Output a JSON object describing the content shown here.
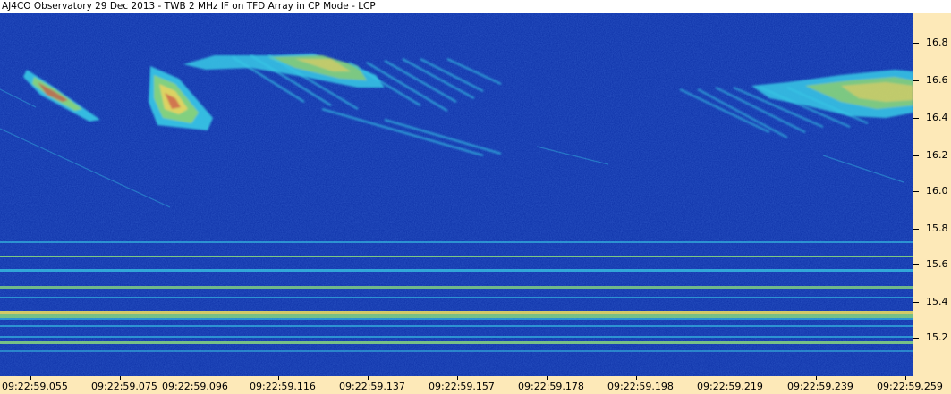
{
  "window": {
    "title": "AJ4CO Observatory 29 Dec 2013 - TWB 2 MHz IF on TFD Array in CP Mode - LCP"
  },
  "axes": {
    "y_unit_note": "",
    "y_ticks": [
      "16.8",
      "16.6",
      "16.4",
      "16.2",
      "16.0",
      "15.8",
      "15.6",
      "15.4",
      "15.2"
    ],
    "x_ticks": [
      "09:22:59.055",
      "09:22:59.075",
      "09:22:59.096",
      "09:22:59.116",
      "09:22:59.137",
      "09:22:59.157",
      "09:22:59.178",
      "09:22:59.198",
      "09:22:59.219",
      "09:22:59.239",
      "09:22:59.259"
    ]
  },
  "colors": {
    "background_blue": "#0b2fa6",
    "axis_panel": "#fde9b8",
    "signal_cyan": "#39c9e6",
    "signal_green": "#8ee07a",
    "signal_yellow": "#f2e35a",
    "signal_red": "#e0503a"
  }
}
